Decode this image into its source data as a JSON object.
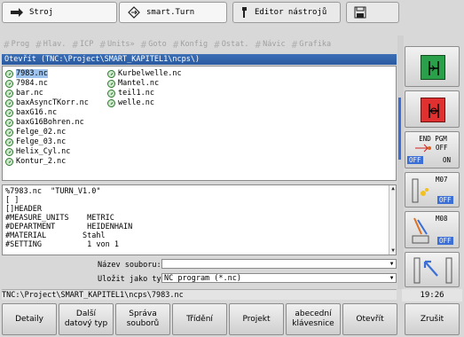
{
  "tabs": [
    {
      "label": "Stroj",
      "icon": "arrow-right-icon"
    },
    {
      "label": "smart.Turn",
      "icon": "diamond-arrows-icon"
    },
    {
      "label": "Editor nástrojů",
      "icon": "tool-icon"
    },
    {
      "label": "",
      "icon": "save-disk-icon"
    }
  ],
  "menu": [
    "Prog",
    "Hlav.",
    "ICP",
    "Units»",
    "Goto",
    "Konfig",
    "Ostat.",
    "Návic",
    "Grafika"
  ],
  "dialog": {
    "title": "Otevřít  (TNC:\\Project\\SMART_KAPITEL1\\ncps\\)",
    "files_col1": [
      "7983.nc",
      "7984.nc",
      "bar.nc",
      "baxAsyncTKorr.nc",
      "baxG16.nc",
      "baxG16Bohren.nc",
      "Felge_02.nc",
      "Felge_03.nc",
      "Helix_Cyl.nc",
      "Kontur_2.nc"
    ],
    "files_col2": [
      "Kurbelwelle.nc",
      "Mantel.nc",
      "teil1.nc",
      "welle.nc"
    ],
    "selected_file": "7983.nc",
    "preview_lines": [
      "%7983.nc  \"TURN_V1.0\"",
      "[ ]",
      "[]HEADER",
      "#MEASURE_UNITS    METRIC",
      "#DEPARTMENT       HEIDENHAIN",
      "#MATERIAL        Stahl",
      "#SETTING          1 von 1"
    ],
    "filename_label": "Název souboru:",
    "filename_value": "",
    "filetype_label": "Uložit jako typ:",
    "filetype_value": "NC program (*.nc)"
  },
  "status_path": "TNC:\\Project\\SMART_KAPITEL1\\ncps\\7983.nc",
  "clock": "19:26",
  "side": {
    "end_pgm": "END PGM",
    "off": "OFF",
    "on": "ON",
    "m07": "M07",
    "m08": "M08",
    "m_off": "OFF"
  },
  "softkeys": [
    "Detaily",
    "Další\ndatový typ",
    "Správa\nsouborů",
    "Třídění",
    "Projekt",
    "abecední\nklávesnice",
    "Otevřít",
    "Zrušit"
  ],
  "colors": {
    "title_bar": "#2f62ab",
    "selection": "#9ec3ee",
    "start": "#2ba04a",
    "stop": "#e03030",
    "accent_off": "#3b6fd6"
  }
}
